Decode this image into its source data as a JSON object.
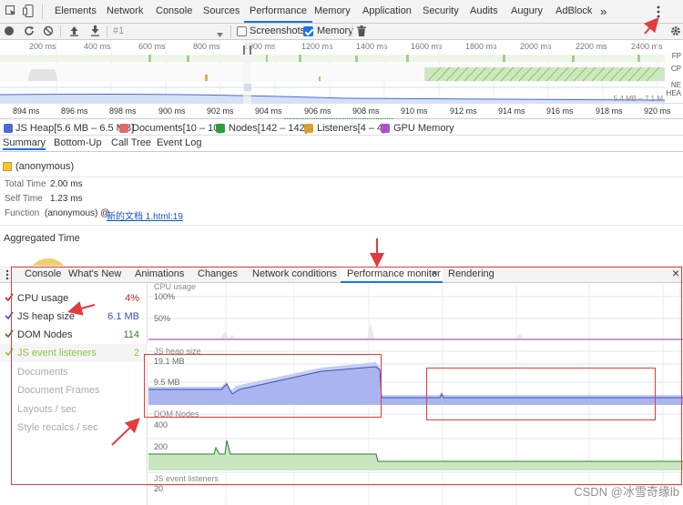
{
  "devtools": {
    "tabs": [
      "Elements",
      "Network",
      "Console",
      "Sources",
      "Performance",
      "Memory",
      "Application",
      "Security",
      "Audits",
      "Augury",
      "AdBlock"
    ],
    "active_tab": "Performance",
    "more_tabs_glyph": "»",
    "menu_icon": "kebab-menu-icon"
  },
  "toolbar": {
    "recording_label": "#1",
    "screenshots_label": "Screenshots",
    "screenshots_checked": false,
    "memory_label": "Memory",
    "memory_checked": true
  },
  "overview": {
    "ticks": [
      "200 ms",
      "400 ms",
      "600 ms",
      "800 ms",
      "1000 ms",
      "1200 ms",
      "1400 ms",
      "1600 ms",
      "1800 ms",
      "2000 ms",
      "2200 ms",
      "2400 ms"
    ],
    "lane_labels": [
      "FP",
      "CP",
      "NE",
      "HEA"
    ],
    "heap_range": "5.4 MB – 7.1 M"
  },
  "ruler": {
    "ticks": [
      "894 ms",
      "896 ms",
      "898 ms",
      "900 ms",
      "902 ms",
      "904 ms",
      "906 ms",
      "908 ms",
      "910 ms",
      "912 ms",
      "914 ms",
      "916 ms",
      "918 ms",
      "920 ms"
    ]
  },
  "counters": [
    {
      "label": "JS Heap[5.6 MB – 6.5 MB]",
      "color": "#4a6bd0",
      "checked": true
    },
    {
      "label": "Documents[10 – 10]",
      "color": "#db6b6b",
      "checked": false
    },
    {
      "label": "Nodes[142 – 142]",
      "color": "#2e9e3e",
      "checked": true
    },
    {
      "label": "Listeners[4 – 4]",
      "color": "#d9a12b",
      "checked": true
    },
    {
      "label": "GPU Memory",
      "color": "#b04fd0",
      "checked": true
    }
  ],
  "bottom_tabs": [
    "Summary",
    "Bottom-Up",
    "Call Tree",
    "Event Log"
  ],
  "summary": {
    "title": "(anonymous)",
    "total_time_label": "Total Time",
    "total_time": "2.00 ms",
    "self_time_label": "Self Time",
    "self_time": "1.23 ms",
    "function_label": "Function",
    "function_value": "(anonymous) @ ",
    "function_link": "新的文档 1.html:19",
    "aggregated_label": "Aggregated Time"
  },
  "drawer": {
    "tabs": [
      "Console",
      "What's New",
      "Animations",
      "Changes",
      "Network conditions",
      "Performance monitor",
      "Rendering"
    ],
    "active_tab": "Performance monitor",
    "close_glyph": "×"
  },
  "metrics": [
    {
      "label": "CPU usage",
      "value": "4%",
      "color": "#c62828",
      "checked": true
    },
    {
      "label": "JS heap size",
      "value": "6.1 MB",
      "color": "#3f51b5",
      "checked": true
    },
    {
      "label": "DOM Nodes",
      "value": "114",
      "color": "#2e7d32",
      "checked": true
    },
    {
      "label": "JS event listeners",
      "value": "2",
      "color": "#8bc34a",
      "checked": true
    },
    {
      "label": "Documents",
      "value": "",
      "color": "#999999",
      "checked": false
    },
    {
      "label": "Document Frames",
      "value": "",
      "color": "#999999",
      "checked": false
    },
    {
      "label": "Layouts / sec",
      "value": "",
      "color": "#999999",
      "checked": false
    },
    {
      "label": "Style recalcs / sec",
      "value": "",
      "color": "#999999",
      "checked": false
    }
  ],
  "graphs": {
    "cpu": {
      "title": "CPU usage",
      "ticks": [
        "100%",
        "50%"
      ]
    },
    "heap": {
      "title": "JS heap size",
      "ticks": [
        "19.1 MB",
        "9.5 MB"
      ]
    },
    "dom": {
      "title": "DOM Nodes",
      "ticks": [
        "400",
        "200"
      ]
    },
    "listeners": {
      "title": "JS event listeners",
      "ticks": [
        "20"
      ]
    }
  },
  "watermark": "CSDN @冰雪奇缘lb"
}
